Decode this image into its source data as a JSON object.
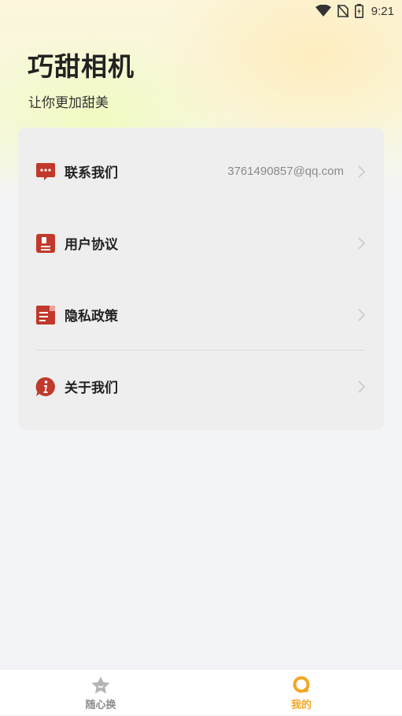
{
  "status_bar": {
    "time": "9:21"
  },
  "header": {
    "title": "巧甜相机",
    "subtitle": "让你更加甜美"
  },
  "menu": {
    "items": [
      {
        "label": "联系我们",
        "value": "3761490857@qq.com"
      },
      {
        "label": "用户协议",
        "value": ""
      },
      {
        "label": "隐私政策",
        "value": ""
      },
      {
        "label": "关于我们",
        "value": ""
      }
    ]
  },
  "bottom_nav": {
    "items": [
      {
        "label": "随心换",
        "active": false
      },
      {
        "label": "我的",
        "active": true
      }
    ]
  },
  "colors": {
    "accent_red": "#c0392b",
    "active_tab": "#f5a623",
    "inactive_tab": "#999999"
  }
}
